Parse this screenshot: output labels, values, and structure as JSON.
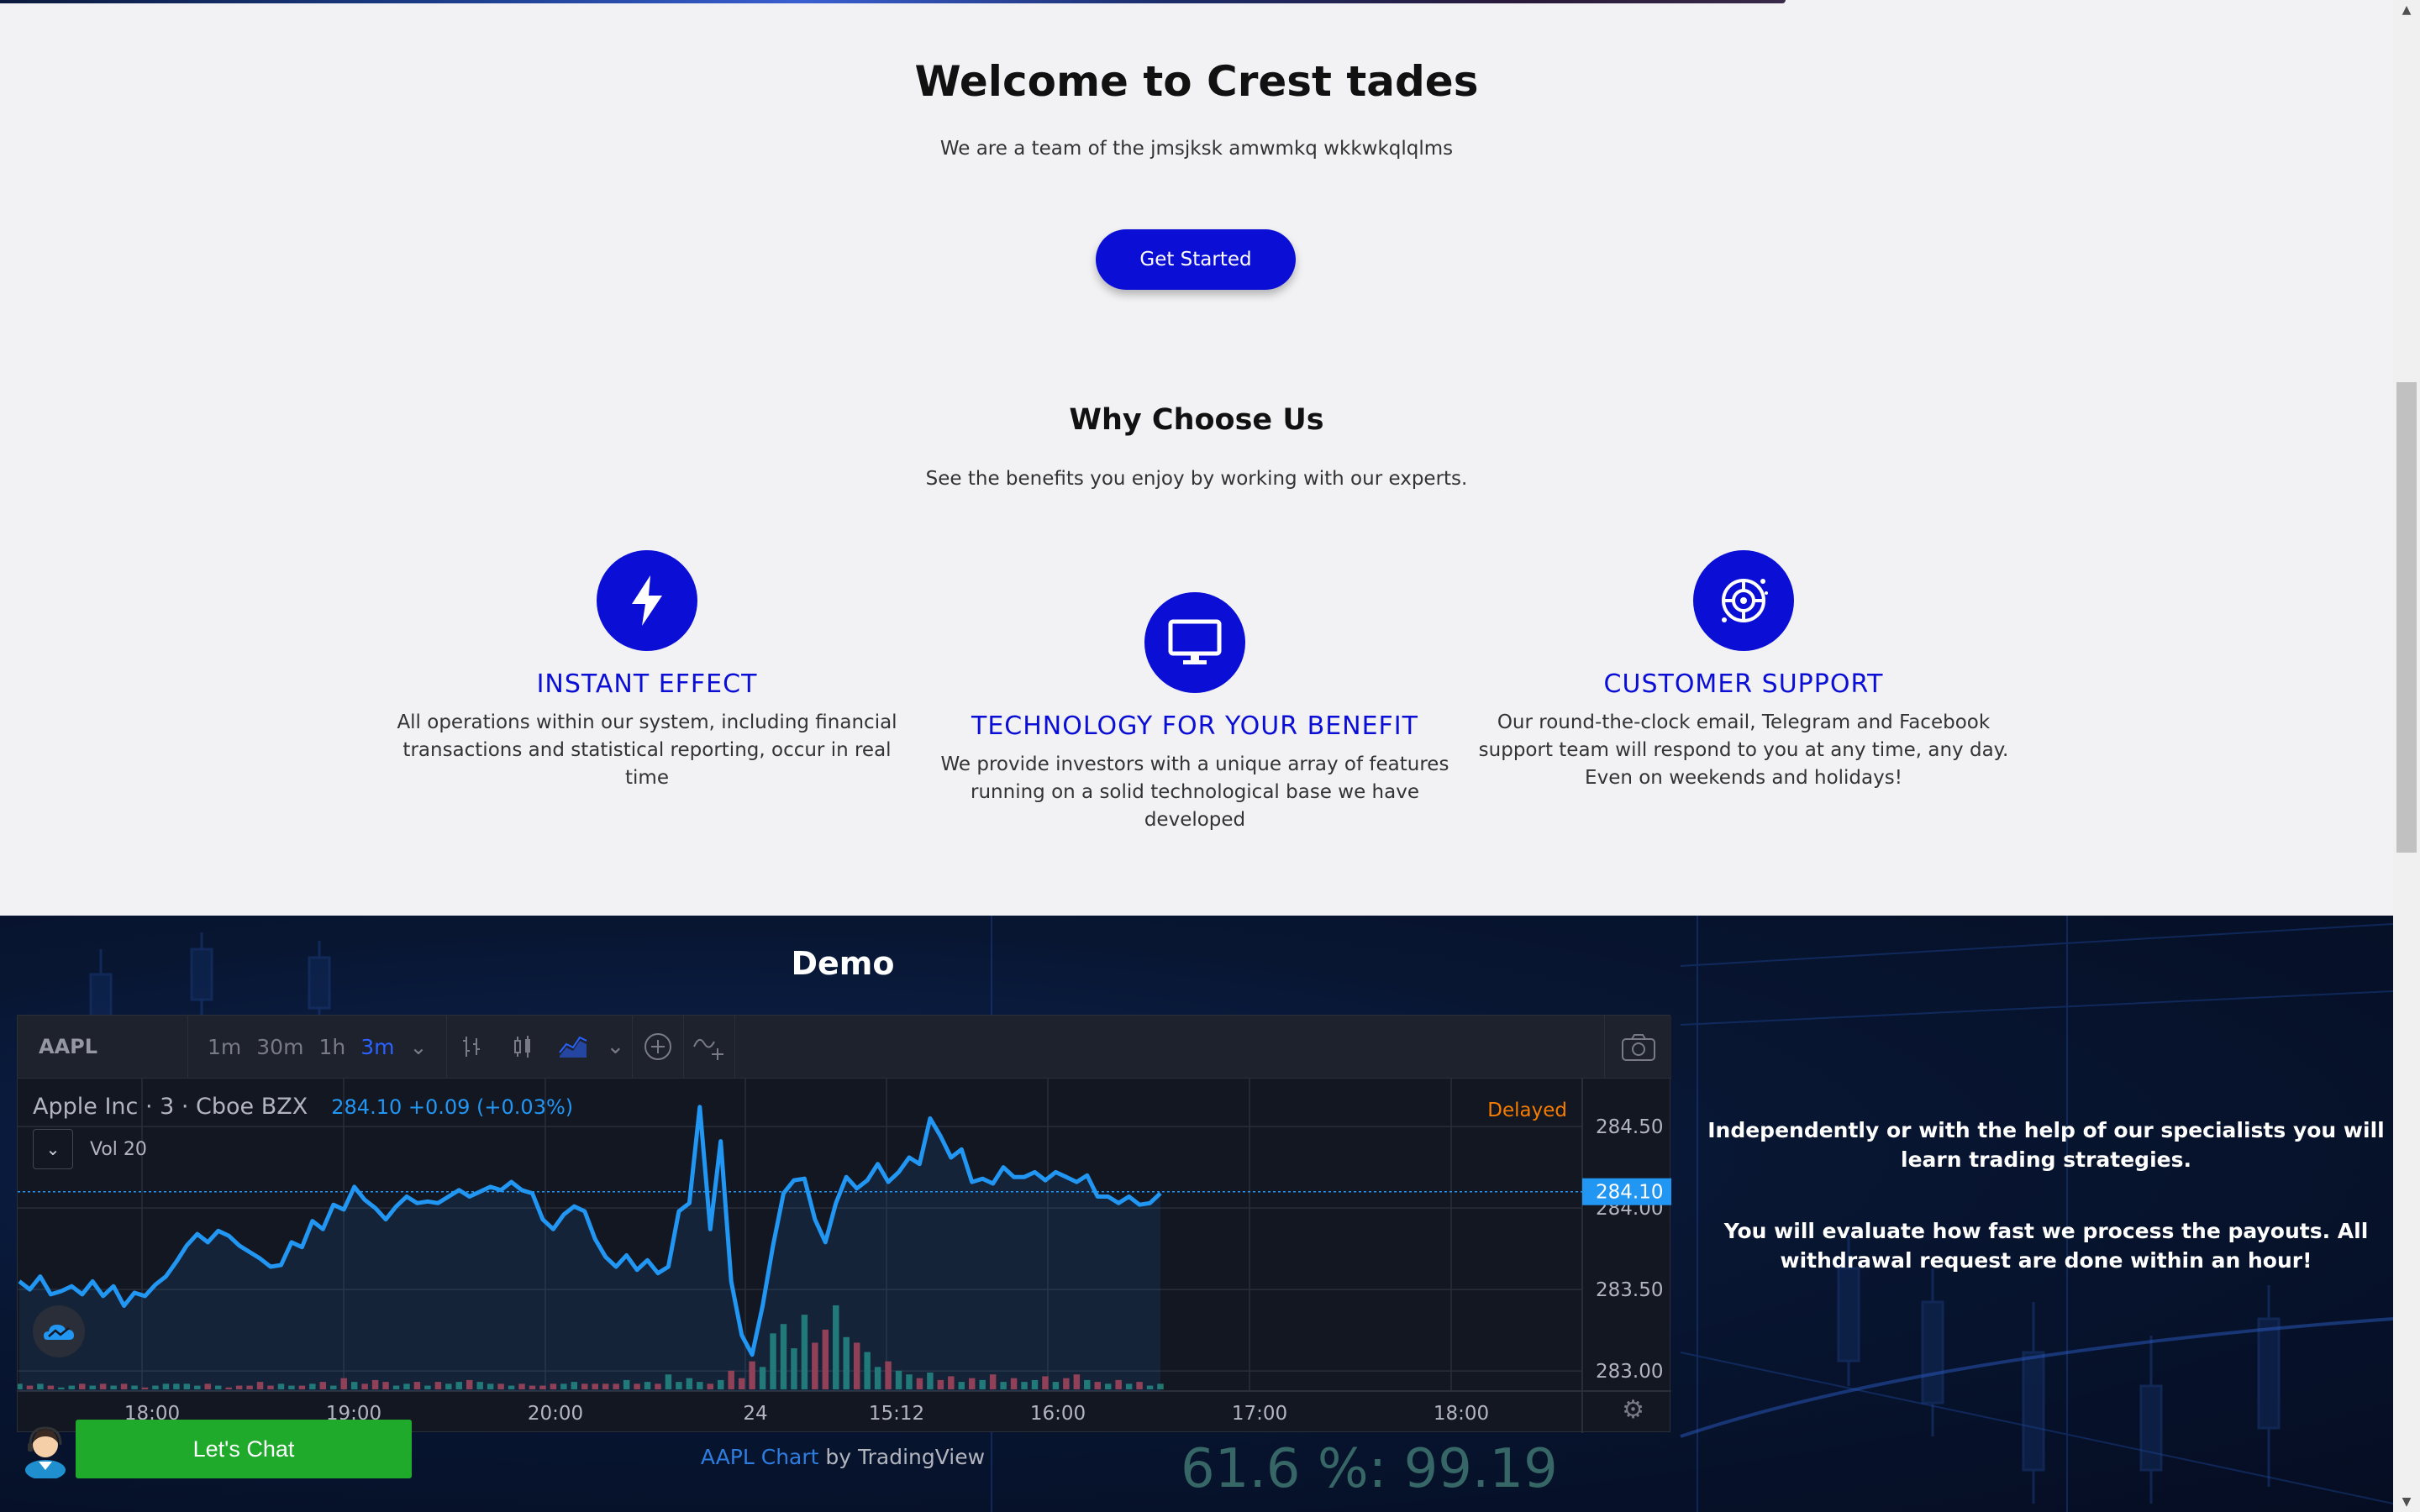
{
  "hero": {
    "title": "Welcome to Crest tades",
    "subtitle": "We are a team of the jmsjksk amwmkq wkkwkqlqlms",
    "cta_label": "Get Started"
  },
  "why": {
    "title": "Why Choose Us",
    "subtitle": "See the benefits you enjoy by working with our experts.",
    "features": [
      {
        "icon": "lightning-icon",
        "title": "INSTANT EFFECT",
        "description": "All operations within our system, including financial transactions and statistical reporting, occur in real time"
      },
      {
        "icon": "monitor-icon",
        "title": "TECHNOLOGY FOR YOUR BENEFIT",
        "description": "We provide investors with a unique array of features running on a solid technological base we have developed"
      },
      {
        "icon": "support-icon",
        "title": "CUSTOMER SUPPORT",
        "description": "Our round-the-clock email, Telegram and Facebook support team will respond to you at any time, any day. Even on weekends and holidays!"
      }
    ]
  },
  "demo": {
    "title": "Demo",
    "widget": {
      "symbol": "AAPL",
      "intervals": [
        "1m",
        "30m",
        "1h",
        "3m"
      ],
      "active_interval": "3m",
      "legend_name": "Apple Inc · 3 · Cboe BZX",
      "legend_price": "284.10 +0.09 (+0.03%)",
      "delayed_label": "Delayed",
      "volume_label": "Vol 20",
      "current_price_tag": "284.10"
    },
    "caption_link": "AAPL Chart",
    "caption_rest": " by TradingView",
    "bg_overlay_text": "61.6 %: 99.19"
  },
  "right_text": {
    "p1": "Independently or with the help of our specialists you will learn trading strategies.",
    "p2": "You will evaluate how fast we process the payouts. All withdrawal request are done within an hour!"
  },
  "chat": {
    "label": "Let's Chat"
  },
  "colors": {
    "brand_blue": "#0b0fd6",
    "chat_green": "#1faa2c",
    "line_blue": "#2196f3"
  },
  "chart_data": {
    "type": "line",
    "symbol": "AAPL",
    "x_tick_labels": [
      "18:00",
      "19:00",
      "20:00",
      "24",
      "15:12",
      "16:00",
      "17:00",
      "18:00"
    ],
    "y_tick_labels": [
      "284.50",
      "284.00",
      "283.50",
      "283.00"
    ],
    "ylim": [
      282.98,
      284.65
    ],
    "last_price": 284.1,
    "prices": [
      283.55,
      283.5,
      283.58,
      283.47,
      283.49,
      283.52,
      283.47,
      283.55,
      283.46,
      283.52,
      283.4,
      283.48,
      283.46,
      283.53,
      283.58,
      283.67,
      283.77,
      283.84,
      283.79,
      283.86,
      283.83,
      283.77,
      283.73,
      283.69,
      283.64,
      283.65,
      283.79,
      283.76,
      283.92,
      283.87,
      284.02,
      283.99,
      284.13,
      284.05,
      284.0,
      283.93,
      284.01,
      284.07,
      284.03,
      284.04,
      284.03,
      284.07,
      284.11,
      284.07,
      284.1,
      284.13,
      284.11,
      284.16,
      284.11,
      284.09,
      283.93,
      283.87,
      283.96,
      284.01,
      283.98,
      283.81,
      283.7,
      283.64,
      283.71,
      283.62,
      283.68,
      283.6,
      283.64,
      283.98,
      284.03,
      284.62,
      283.87,
      284.41,
      283.55,
      283.22,
      283.1,
      283.4,
      283.77,
      284.09,
      284.17,
      284.18,
      283.93,
      283.79,
      284.03,
      284.19,
      284.12,
      284.17,
      284.27,
      284.16,
      284.22,
      284.31,
      284.27,
      284.55,
      284.44,
      284.31,
      284.36,
      284.16,
      284.18,
      284.15,
      284.25,
      284.19,
      284.19,
      284.22,
      284.17,
      284.22,
      284.19,
      284.16,
      284.2,
      284.07,
      284.07,
      284.03,
      284.07,
      284.02,
      284.03,
      284.09
    ],
    "volumes": [
      3,
      2,
      3,
      2,
      1,
      2,
      3,
      2,
      3,
      2,
      3,
      2,
      1,
      2,
      3,
      3,
      3,
      2,
      3,
      2,
      1,
      2,
      2,
      4,
      2,
      3,
      2,
      2,
      3,
      4,
      2,
      6,
      4,
      3,
      5,
      4,
      2,
      3,
      4,
      2,
      4,
      3,
      4,
      5,
      4,
      3,
      3,
      2,
      3,
      2,
      2,
      3,
      3,
      4,
      3,
      3,
      3,
      3,
      5,
      3,
      4,
      3,
      8,
      4,
      6,
      4,
      3,
      5,
      10,
      6,
      15,
      12,
      30,
      35,
      22,
      40,
      25,
      32,
      45,
      28,
      25,
      20,
      12,
      15,
      10,
      8,
      6,
      9,
      5,
      7,
      4,
      6,
      5,
      8,
      4,
      6,
      4,
      5,
      7,
      4,
      6,
      8,
      5,
      4,
      3,
      5,
      3,
      4,
      2,
      3
    ]
  }
}
